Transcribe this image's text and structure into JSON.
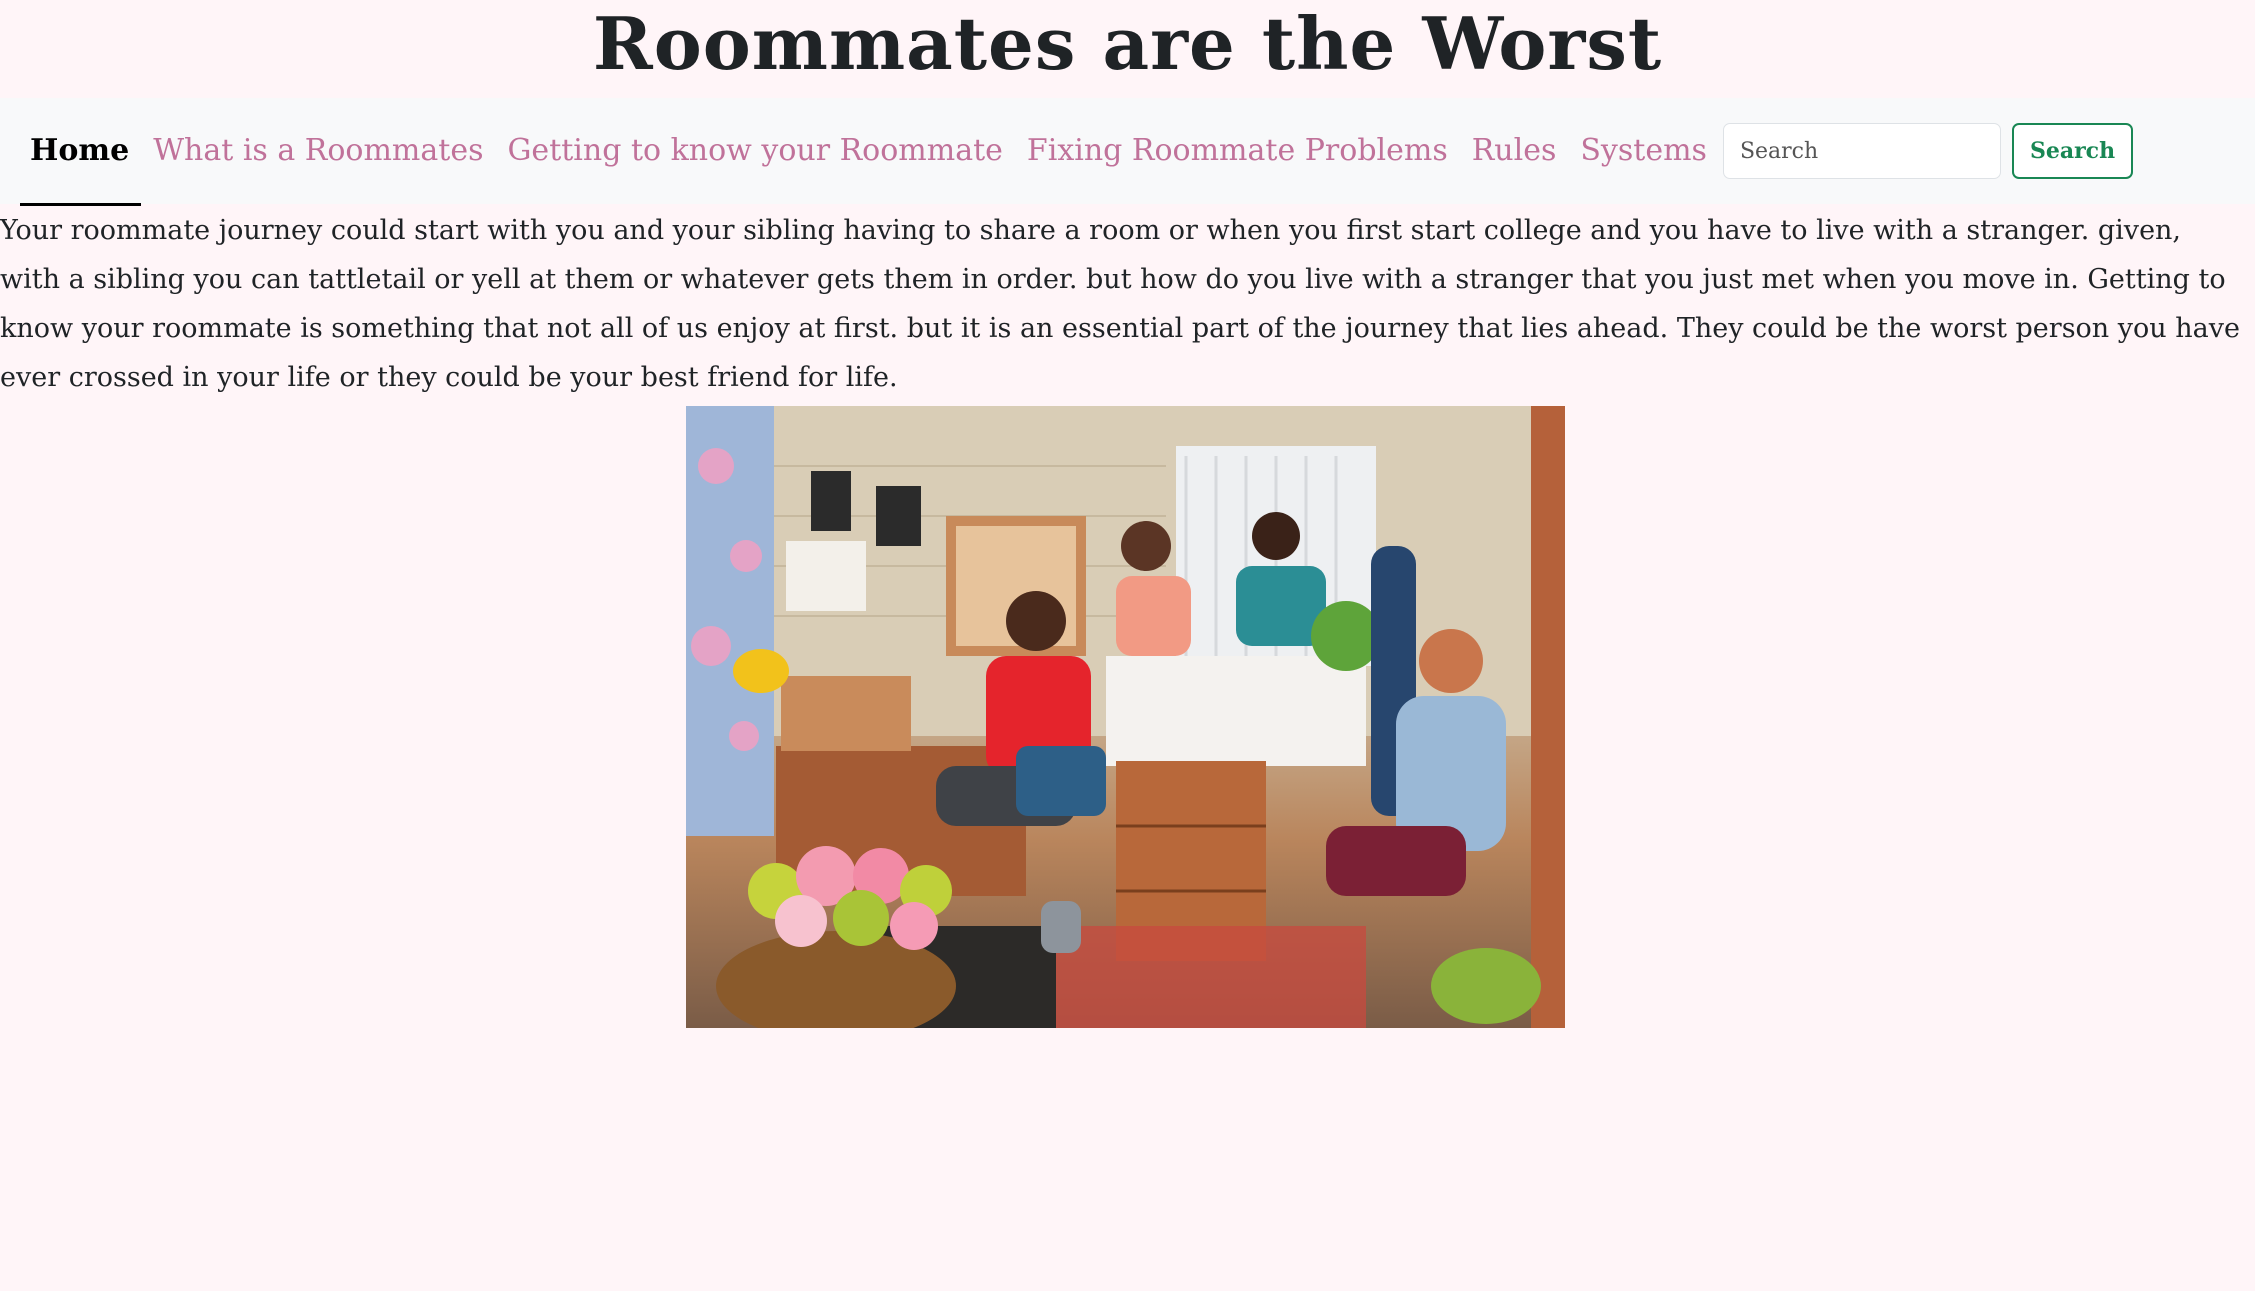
{
  "header": {
    "title": "Roommates are the Worst"
  },
  "nav": {
    "items": [
      {
        "label": "Home",
        "active": true
      },
      {
        "label": "What is a Roommates"
      },
      {
        "label": "Getting to know your Roommate"
      },
      {
        "label": "Fixing Roommate Problems"
      },
      {
        "label": "Rules"
      },
      {
        "label": "Systems"
      }
    ],
    "search_placeholder": "Search",
    "search_button": "Search"
  },
  "main": {
    "intro": "Your roommate journey could start with you and your sibling having to share a room or when you first start college and you have to live with a stranger. given, with a sibling you can tattletail or yell at them or whatever gets them in order. but how do you live with a stranger that you just met when you move in. Getting to know your roommate is something that not all of us enjoy at first. but it is an essential part of the journey that lies ahead. They could be the worst person you have ever crossed in your life or they could be your best friend for life.",
    "image": {
      "subject": "four roommates in a dorm room",
      "icon": "photo-icon"
    }
  },
  "colors": {
    "background": "#fff5f8",
    "navbar": "#f8f9fa",
    "nav_link": "#c0729a",
    "accent_green": "#198754"
  }
}
